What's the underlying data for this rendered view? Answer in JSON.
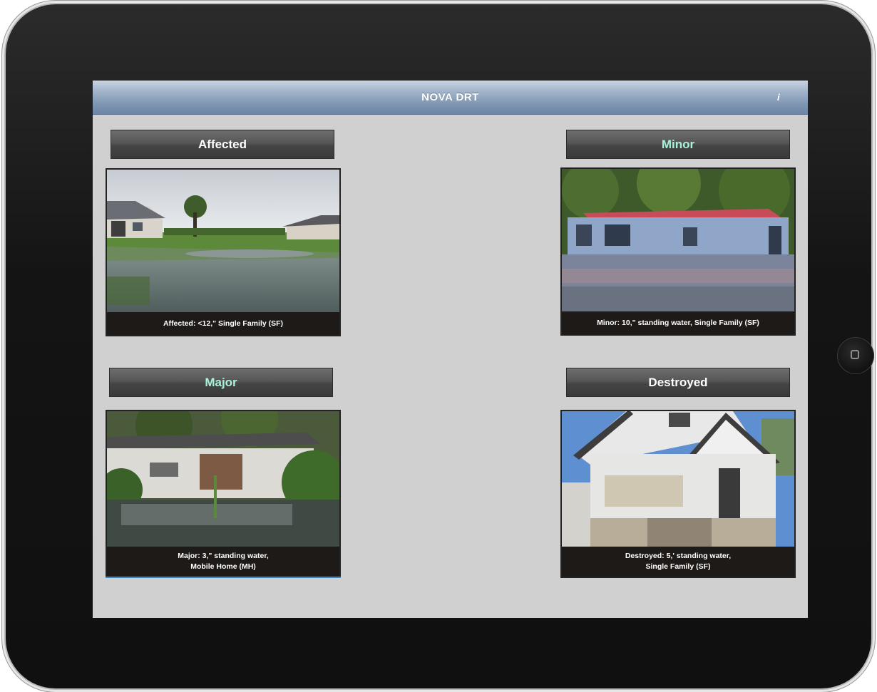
{
  "app": {
    "title": "NOVA DRT",
    "info_glyph": "i"
  },
  "cards": [
    {
      "id": "affected",
      "header": "Affected",
      "header_color": "#ffffff",
      "caption": "Affected: <12,\" Single Family (SF)",
      "photo": "flooded-lawn-single-family"
    },
    {
      "id": "minor",
      "header": "Minor",
      "header_color": "#a9f3dc",
      "caption": "Minor: 10,\" standing water, Single Family (SF)",
      "photo": "flooded-blue-house-red-roof"
    },
    {
      "id": "major",
      "header": "Major",
      "header_color": "#a9f3dc",
      "caption_line1": "Major: 3,\" standing water,",
      "caption_line2": "Mobile Home (MH)",
      "photo": "flooded-mobile-home"
    },
    {
      "id": "destroyed",
      "header": "Destroyed",
      "header_color": "#ffffff",
      "caption_line1": "Destroyed: 5,' standing water,",
      "caption_line2": "Single Family (SF)",
      "photo": "water-damaged-white-house"
    }
  ],
  "colors": {
    "screen_bg": "#d0d0d0",
    "navbar": "#7f96b3",
    "header_accent": "#a9f3dc",
    "selection_underline": "#3a86c8"
  }
}
